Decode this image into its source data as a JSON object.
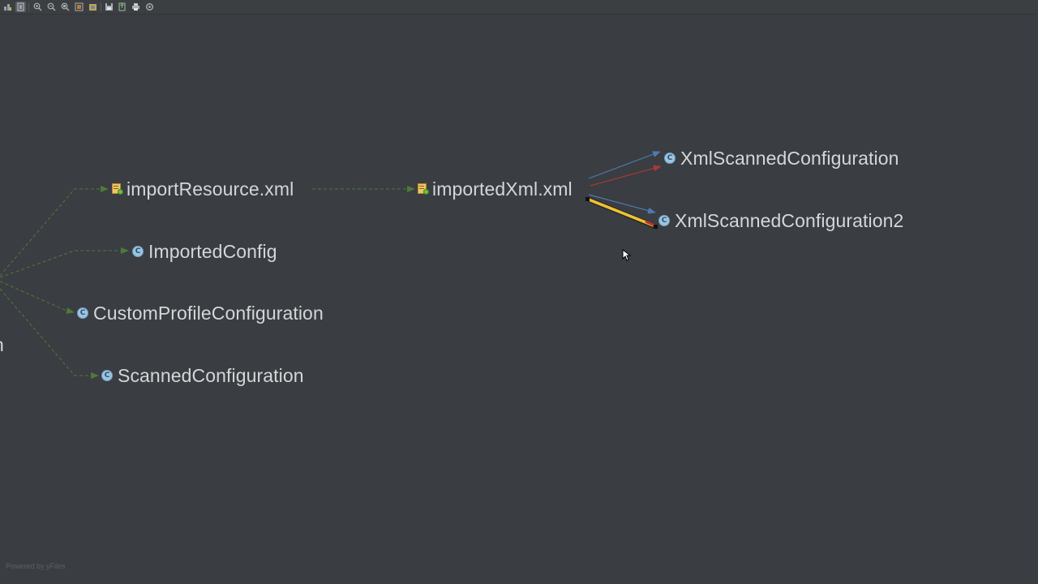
{
  "nodes": {
    "import_resource": {
      "label": "importResource.xml",
      "icon": "xml-file-icon"
    },
    "imported_xml": {
      "label": "importedXml.xml",
      "icon": "xml-file-icon"
    },
    "xml_scanned_1": {
      "label": "XmlScannedConfiguration",
      "icon": "class-icon"
    },
    "xml_scanned_2": {
      "label": "XmlScannedConfiguration2",
      "icon": "class-icon"
    },
    "imported_config": {
      "label": "ImportedConfig",
      "icon": "class-icon"
    },
    "custom_profile": {
      "label": "CustomProfileConfiguration",
      "icon": "class-icon"
    },
    "scanned_config": {
      "label": "ScannedConfiguration",
      "icon": "class-icon"
    },
    "partial_left": {
      "label": "n"
    }
  },
  "class_icon_letter": "C",
  "footer": {
    "text": "Powered by yFiles"
  },
  "colors": {
    "background": "#3a3d41",
    "edge_green": "#4f7a3a",
    "edge_blue": "#4f79b0",
    "edge_red": "#a33a3a",
    "highlight_yellow": "#f2c230",
    "label": "#d4d6d8",
    "class_icon": "#9cc4e0"
  },
  "toolbar": {
    "buttons": [
      "layout-icon",
      "actual-size-icon",
      "zoom-in-icon",
      "zoom-out-icon",
      "zoom-fit-icon",
      "fit-content-icon",
      "apply-layout-icon",
      "save-icon",
      "export-icon",
      "print-icon",
      "settings-icon"
    ]
  }
}
